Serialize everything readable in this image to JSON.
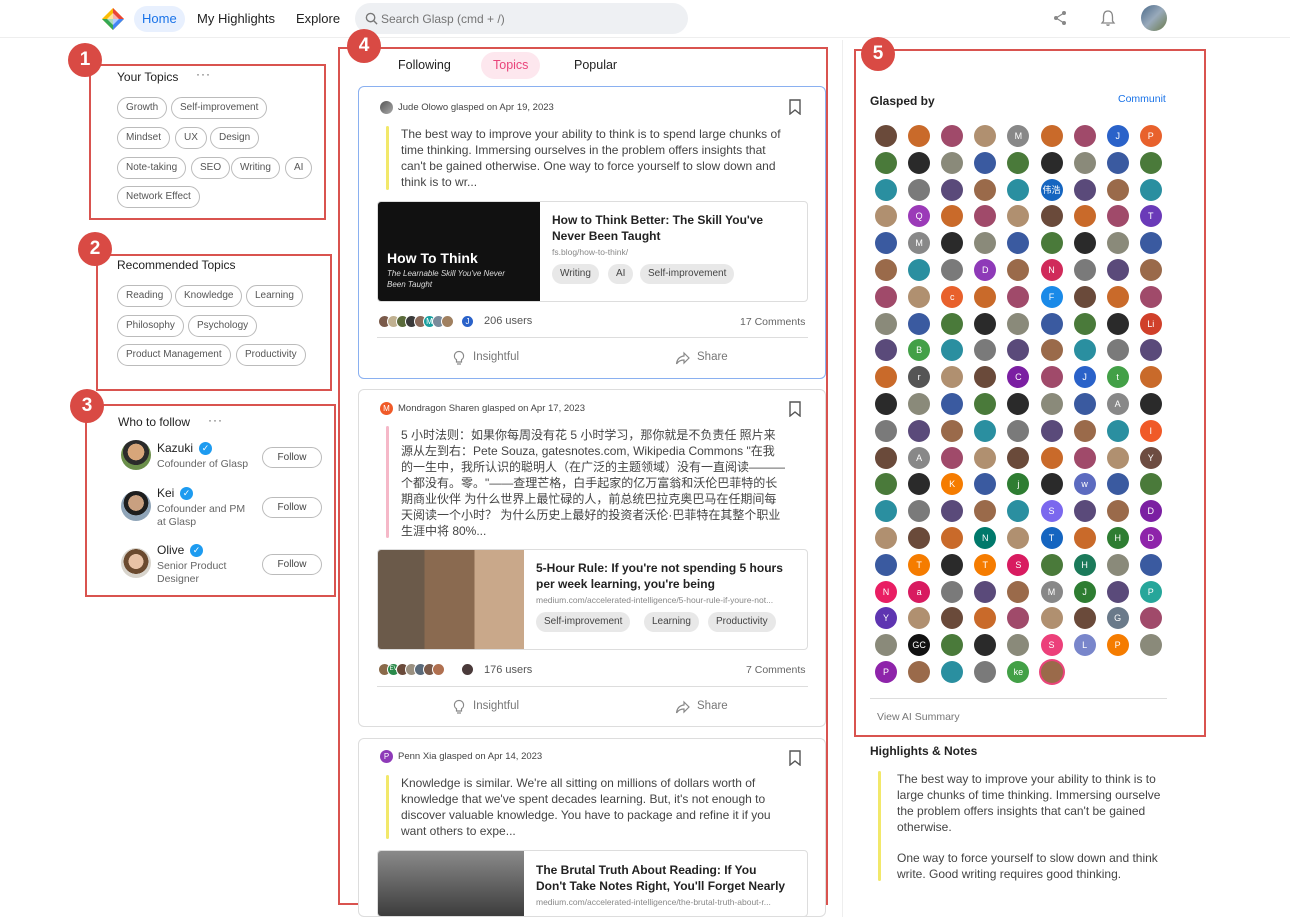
{
  "nav": {
    "home": "Home",
    "highlights": "My Highlights",
    "explore": "Explore",
    "search_placeholder": "Search Glasp (cmd + /)"
  },
  "annotations": [
    "1",
    "2",
    "3",
    "4",
    "5"
  ],
  "your_topics": {
    "title": "Your Topics",
    "more": "···",
    "chips": [
      "Growth",
      "Self-improvement",
      "Mindset",
      "UX",
      "Design",
      "Note-taking",
      "SEO",
      "Writing",
      "AI",
      "Network Effect"
    ]
  },
  "recommended_topics": {
    "title": "Recommended Topics",
    "chips": [
      "Reading",
      "Knowledge",
      "Learning",
      "Philosophy",
      "Psychology",
      "Product Management",
      "Productivity"
    ]
  },
  "who_to_follow": {
    "title": "Who to follow",
    "more": "···",
    "follow_label": "Follow",
    "users": [
      {
        "name": "Kazuki",
        "role": "Cofounder of Glasp"
      },
      {
        "name": "Kei",
        "role_line1": "Cofounder and PM",
        "role_line2": "at Glasp"
      },
      {
        "name": "Olive",
        "role_line1": "Senior Product",
        "role_line2": "Designer"
      }
    ]
  },
  "feed": {
    "tabs": [
      "Following",
      "Topics",
      "Popular"
    ],
    "active_tab": "Topics",
    "posts": [
      {
        "author": "Jude Olowo",
        "action": "glasped on Apr 19, 2023",
        "quote": [
          "The best way to improve your ability to think is to spend large chunks of",
          "time thinking. Immersing ourselves in the problem offers insights that",
          "can't be gained otherwise. One way to force yourself to slow down and",
          "think is to wr..."
        ],
        "thumb_title": "How To Think",
        "thumb_subtitle_1": "The Learnable Skill You've Never",
        "thumb_subtitle_2": "Been Taught",
        "link_title_1": "How to Think Better: The Skill You've",
        "link_title_2": "Never Been Taught",
        "link_url": "fs.blog/how-to-think/",
        "tags": [
          "Writing",
          "AI",
          "Self-improvement"
        ],
        "users": "206 users",
        "comments": "17 Comments",
        "insightful": "Insightful",
        "share": "Share",
        "stack_letters": [
          "",
          "",
          "",
          "",
          "M",
          "",
          "",
          "J"
        ]
      },
      {
        "author": "Mondragon Sharen",
        "author_initial": "M",
        "action": "glasped on Apr 17, 2023",
        "quote": [
          "5 小时法则：如果你每周没有花 5 小时学习，那你就是不负责任 照片来",
          "源从左到右：Pete Souza, gatesnotes.com, Wikipedia Commons \"在我",
          "的一生中，我所认识的聪明人（在广泛的主题领域）没有一直阅读———",
          "个都没有。零。\"——查理芒格，白手起家的亿万富翁和沃伦巴菲特的长",
          "期商业伙伴 为什么世界上最忙碌的人，前总统巴拉克奥巴马在任期间每",
          "天阅读一个小时？ 为什么历史上最好的投资者沃伦·巴菲特在其整个职业",
          "生涯中将 80%..."
        ],
        "link_title_1": "5-Hour Rule: If you're not spending 5 hours",
        "link_title_2": "per week learning, you're being",
        "link_url": "medium.com/accelerated-intelligence/5-hour-rule-if-youre-not...",
        "tags": [
          "Self-improvement",
          "Learning",
          "Productivity"
        ],
        "users": "176 users",
        "comments": "7 Comments",
        "insightful": "Insightful",
        "share": "Share",
        "stack_letters": [
          "",
          "EV",
          "",
          "",
          "",
          "",
          "",
          ""
        ]
      },
      {
        "author": "Penn Xia",
        "author_initial": "P",
        "action": "glasped on Apr 14, 2023",
        "quote": [
          "Knowledge is similar. We're all sitting on millions of dollars worth of",
          "knowledge that we've spent decades learning. But, it's not enough to",
          "discover valuable knowledge. You have to package and refine it if you",
          "want others to expe..."
        ],
        "link_title_1": "The Brutal Truth About Reading: If You",
        "link_title_2": "Don't Take Notes Right, You'll Forget Nearly",
        "link_url": "medium.com/accelerated-intelligence/the-brutal-truth-about-r..."
      }
    ]
  },
  "glasped_by": {
    "title": "Glasped by",
    "tab": "Communit",
    "view_summary": "View AI Summary",
    "avatars": [
      [
        "",
        "",
        "",
        "",
        "M",
        "",
        "",
        "J",
        "P"
      ],
      [
        "",
        "",
        "",
        "",
        "",
        "",
        "",
        "",
        ""
      ],
      [
        "",
        "",
        "",
        "",
        "",
        "伟浩",
        "",
        "",
        ""
      ],
      [
        "",
        "Q",
        "",
        "",
        "",
        "",
        "",
        "",
        "T"
      ],
      [
        "",
        "M",
        "",
        "",
        "",
        "",
        "",
        "",
        ""
      ],
      [
        "",
        "",
        "",
        "D",
        "",
        "N",
        "",
        "",
        ""
      ],
      [
        "",
        "",
        "c",
        "",
        "",
        "F",
        "",
        "",
        ""
      ],
      [
        "",
        "",
        "",
        "",
        "",
        "",
        "",
        "",
        "Li"
      ],
      [
        "",
        "B",
        "",
        "",
        "",
        "",
        "",
        "",
        ""
      ],
      [
        "",
        "r",
        "",
        "",
        "C",
        "",
        "J",
        "t",
        ""
      ],
      [
        "",
        "",
        "",
        "",
        "",
        "",
        "",
        "A",
        ""
      ],
      [
        "",
        "",
        "",
        "",
        "",
        "",
        "",
        "",
        "I"
      ],
      [
        "",
        "A",
        "",
        "",
        "",
        "",
        "",
        "",
        "Y"
      ],
      [
        "",
        "",
        "K",
        "",
        "j",
        "",
        "w",
        "",
        ""
      ],
      [
        "",
        "",
        "",
        "",
        "",
        "S",
        "",
        "",
        "D"
      ],
      [
        "",
        "",
        "",
        "N",
        "",
        "T",
        "",
        "H",
        "D"
      ],
      [
        "",
        "T",
        "",
        "T",
        "S",
        "",
        "H",
        "",
        ""
      ],
      [
        "N",
        "a",
        "",
        "",
        "",
        "M",
        "J",
        "",
        "P"
      ],
      [
        "Y",
        "",
        "",
        "",
        "",
        "",
        "",
        "G",
        ""
      ],
      [
        "",
        "GC",
        "",
        "",
        "",
        "S",
        "L",
        "P",
        ""
      ],
      [
        "P",
        "",
        "",
        "",
        "ke",
        ""
      ]
    ]
  },
  "highlights_notes": {
    "title": "Highlights & Notes",
    "para1": [
      "The best way to improve your ability to think is to",
      "large chunks of time thinking. Immersing ourselve",
      "the problem offers insights that can't be gained",
      "otherwise."
    ],
    "para2": [
      "One way to force yourself to slow down and think",
      "write. Good writing requires good thinking."
    ]
  },
  "colors": {
    "accent": "#1a73e8",
    "annotation": "#d9534f",
    "tab_active": "#e9447a",
    "quote_yellow": "#f2e86a",
    "quote_pink": "#f5b8c8"
  }
}
